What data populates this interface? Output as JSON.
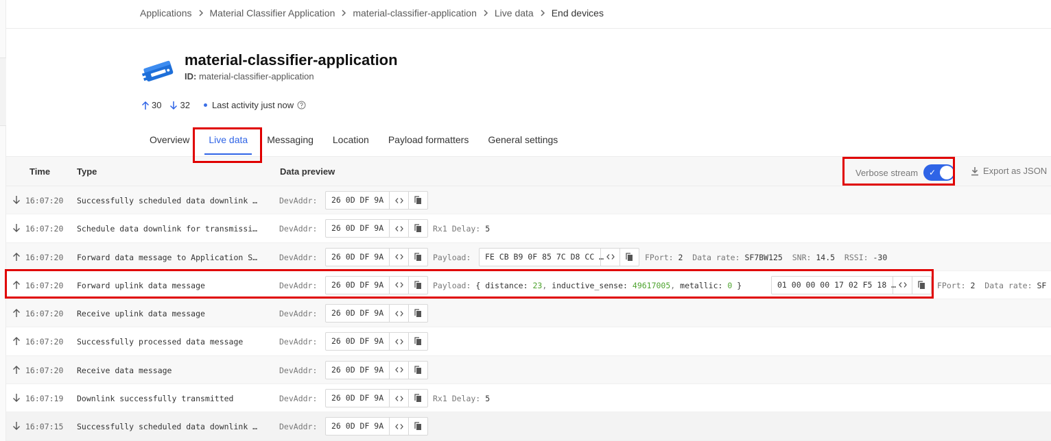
{
  "breadcrumb": [
    "Applications",
    "Material Classifier Application",
    "material-classifier-application",
    "Live data",
    "End devices"
  ],
  "app": {
    "title": "material-classifier-application",
    "id_label": "ID:",
    "id_value": "material-classifier-application"
  },
  "stats": {
    "uplink": "30",
    "downlink": "32",
    "activity": "Last activity just now"
  },
  "tabs": [
    "Overview",
    "Live data",
    "Messaging",
    "Location",
    "Payload formatters",
    "General settings"
  ],
  "table": {
    "headers": {
      "time": "Time",
      "type": "Type",
      "preview": "Data preview"
    },
    "verbose_label": "Verbose stream",
    "verbose_on": true,
    "export_label": "Export as JSON"
  },
  "rows": [
    {
      "dir": "down",
      "time": "16:07:20",
      "type": "Successfully scheduled data downlink …",
      "devaddr_label": "DevAddr:",
      "devaddr": "26 0D DF 9A"
    },
    {
      "dir": "down",
      "time": "16:07:20",
      "type": "Schedule data downlink for transmissi…",
      "devaddr_label": "DevAddr:",
      "devaddr": "26 0D DF 9A",
      "extra_label": "Rx1 Delay:",
      "extra_value": "5"
    },
    {
      "dir": "up",
      "time": "16:07:20",
      "type": "Forward data message to Application S…",
      "devaddr_label": "DevAddr:",
      "devaddr": "26 0D DF 9A",
      "payload_label": "Payload:",
      "payload_hex": "FE CB B9 0F 85 7C D8 CC …",
      "fport_label": "FPort:",
      "fport": "2",
      "datarate_label": "Data rate:",
      "datarate": "SF7BW125",
      "snr_label": "SNR:",
      "snr": "14.5",
      "rssi_label": "RSSI:",
      "rssi": "-30"
    },
    {
      "dir": "up",
      "time": "16:07:20",
      "type": "Forward uplink data message",
      "devaddr_label": "DevAddr:",
      "devaddr": "26 0D DF 9A",
      "payload_label": "Payload:",
      "decoded": {
        "open": "{",
        "distance_key": "distance:",
        "distance": "23",
        "inductive_key": "inductive_sense:",
        "inductive": "49617005",
        "metallic_key": "metallic:",
        "metallic": "0",
        "close": "}"
      },
      "payload_hex": "01 00 00 00 17 02 F5 18 …",
      "fport_label": "FPort:",
      "fport": "2",
      "datarate_label": "Data rate:",
      "datarate": "SF"
    },
    {
      "dir": "up",
      "time": "16:07:20",
      "type": "Receive uplink data message",
      "devaddr_label": "DevAddr:",
      "devaddr": "26 0D DF 9A"
    },
    {
      "dir": "up",
      "time": "16:07:20",
      "type": "Successfully processed data message",
      "devaddr_label": "DevAddr:",
      "devaddr": "26 0D DF 9A"
    },
    {
      "dir": "up",
      "time": "16:07:20",
      "type": "Receive data message",
      "devaddr_label": "DevAddr:",
      "devaddr": "26 0D DF 9A"
    },
    {
      "dir": "down",
      "time": "16:07:19",
      "type": "Downlink successfully transmitted",
      "devaddr_label": "DevAddr:",
      "devaddr": "26 0D DF 9A",
      "extra_label": "Rx1 Delay:",
      "extra_value": "5"
    },
    {
      "dir": "down",
      "time": "16:07:15",
      "type": "Successfully scheduled data downlink …",
      "devaddr_label": "DevAddr:",
      "devaddr": "26 0D DF 9A"
    }
  ],
  "colors": {
    "accent": "#2f64e6",
    "highlight": "#e00000",
    "number": "#4da32e"
  }
}
